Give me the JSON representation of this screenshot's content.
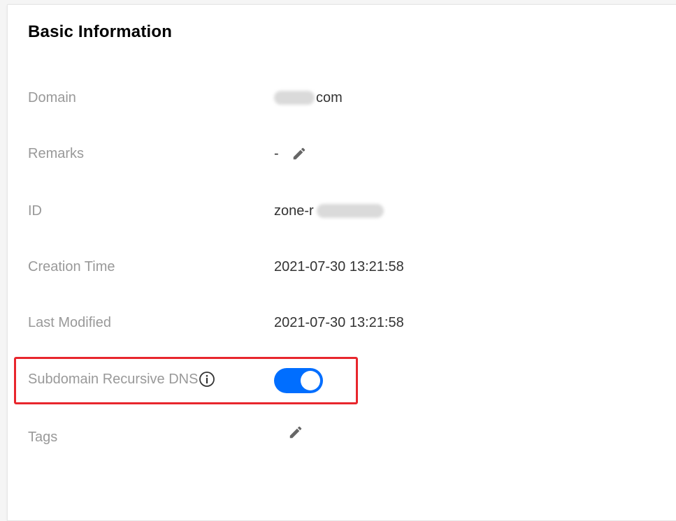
{
  "panel": {
    "title": "Basic Information"
  },
  "fields": {
    "domain": {
      "label": "Domain",
      "value_suffix": "com"
    },
    "remarks": {
      "label": "Remarks",
      "value": "-"
    },
    "id": {
      "label": "ID",
      "value_prefix": "zone-r"
    },
    "creation_time": {
      "label": "Creation Time",
      "value": "2021-07-30 13:21:58"
    },
    "last_modified": {
      "label": "Last Modified",
      "value": "2021-07-30 13:21:58"
    },
    "recursive_dns": {
      "label": "Subdomain Recursive DNS",
      "enabled": true
    },
    "tags": {
      "label": "Tags"
    }
  },
  "icons": {
    "remarks_edit": "pencil-icon",
    "tags_edit": "pencil-icon",
    "recursive_dns_info": "info-circle-icon"
  },
  "colors": {
    "toggle_on": "#006eff",
    "highlight": "#e8262d",
    "label": "#999999",
    "value": "#333333"
  }
}
